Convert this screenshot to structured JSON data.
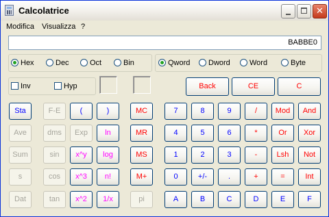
{
  "window": {
    "title": "Calcolatrice",
    "icon": "calculator-icon",
    "min_glyph": "",
    "max_glyph": "",
    "close_glyph": "✕"
  },
  "menu": [
    "Modifica",
    "Visualizza",
    "?"
  ],
  "display": {
    "value": "BABBE0"
  },
  "base": {
    "options": [
      "Hex",
      "Dec",
      "Oct",
      "Bin"
    ],
    "selected": "Hex"
  },
  "word_size": {
    "options": [
      "Qword",
      "Dword",
      "Word",
      "Byte"
    ],
    "selected": "Qword"
  },
  "checkboxes": [
    {
      "label": "Inv",
      "checked": false
    },
    {
      "label": "Hyp",
      "checked": false
    }
  ],
  "top_buttons": [
    "Back",
    "CE",
    "C"
  ],
  "rows": [
    [
      "Sta",
      "F-E",
      "(",
      ")",
      "MC",
      "7",
      "8",
      "9",
      "/",
      "Mod",
      "And"
    ],
    [
      "Ave",
      "dms",
      "Exp",
      "ln",
      "MR",
      "4",
      "5",
      "6",
      "*",
      "Or",
      "Xor"
    ],
    [
      "Sum",
      "sin",
      "x^y",
      "log",
      "MS",
      "1",
      "2",
      "3",
      "-",
      "Lsh",
      "Not"
    ],
    [
      "s",
      "cos",
      "x^3",
      "n!",
      "M+",
      "0",
      "+/-",
      ".",
      "+",
      "=",
      "Int"
    ],
    [
      "Dat",
      "tan",
      "x^2",
      "1/x",
      "pi",
      "A",
      "B",
      "C",
      "D",
      "E",
      "F"
    ]
  ],
  "styles": [
    [
      "blue",
      "dis",
      "blue",
      "blue",
      "red",
      "blue",
      "blue",
      "blue",
      "red",
      "red",
      "red"
    ],
    [
      "dis",
      "dis",
      "dis",
      "mag",
      "red",
      "blue",
      "blue",
      "blue",
      "red",
      "red",
      "red"
    ],
    [
      "dis",
      "dis",
      "mag",
      "mag",
      "red",
      "blue",
      "blue",
      "blue",
      "red",
      "red",
      "red"
    ],
    [
      "dis",
      "dis",
      "mag",
      "mag",
      "red",
      "blue",
      "blue",
      "blue",
      "red",
      "red",
      "red"
    ],
    [
      "dis",
      "dis",
      "mag",
      "mag",
      "dis",
      "blue",
      "blue",
      "blue",
      "blue",
      "blue",
      "blue"
    ]
  ],
  "colors": {
    "blue": "#0000FF",
    "red": "#FF0000",
    "magenta": "#FF00FF",
    "disabled": "#A6A59C"
  }
}
